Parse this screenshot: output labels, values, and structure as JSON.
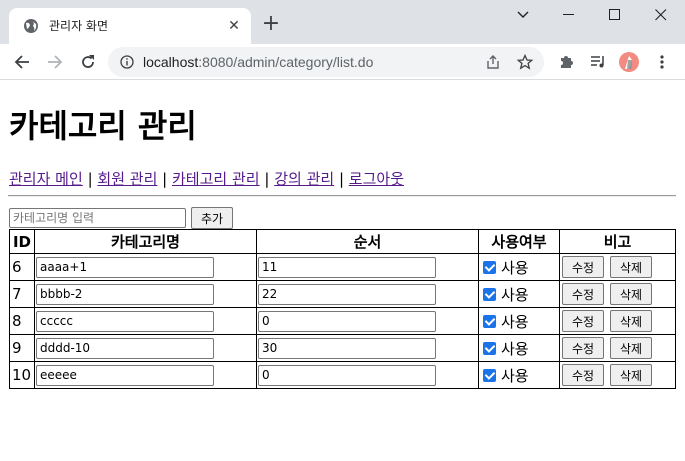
{
  "browser": {
    "tab_title": "관리자 화면",
    "url_host": "localhost",
    "url_rest": ":8080/admin/category/list.do"
  },
  "page": {
    "title": "카테고리 관리",
    "menu": [
      "관리자 메인",
      "회원 관리",
      "카테고리 관리",
      "강의 관리",
      "로그아웃"
    ],
    "menu_separator": "|",
    "add_placeholder": "카테고리명 입력",
    "add_button": "추가"
  },
  "table": {
    "headers": [
      "ID",
      "카테고리명",
      "순서",
      "사용여부",
      "비고"
    ],
    "use_label": "사용",
    "edit_label": "수정",
    "delete_label": "삭제",
    "rows": [
      {
        "id": "6",
        "name": "aaaa+1",
        "order": "11",
        "used": true
      },
      {
        "id": "7",
        "name": "bbbb-2",
        "order": "22",
        "used": true
      },
      {
        "id": "8",
        "name": "ccccc",
        "order": "0",
        "used": true
      },
      {
        "id": "9",
        "name": "dddd-10",
        "order": "30",
        "used": true
      },
      {
        "id": "10",
        "name": "eeeee",
        "order": "0",
        "used": true
      }
    ]
  },
  "colors": {
    "checkbox": "#1a73e8",
    "visited_link": "#551a8b",
    "chrome_titlebar": "#dee1e6"
  }
}
